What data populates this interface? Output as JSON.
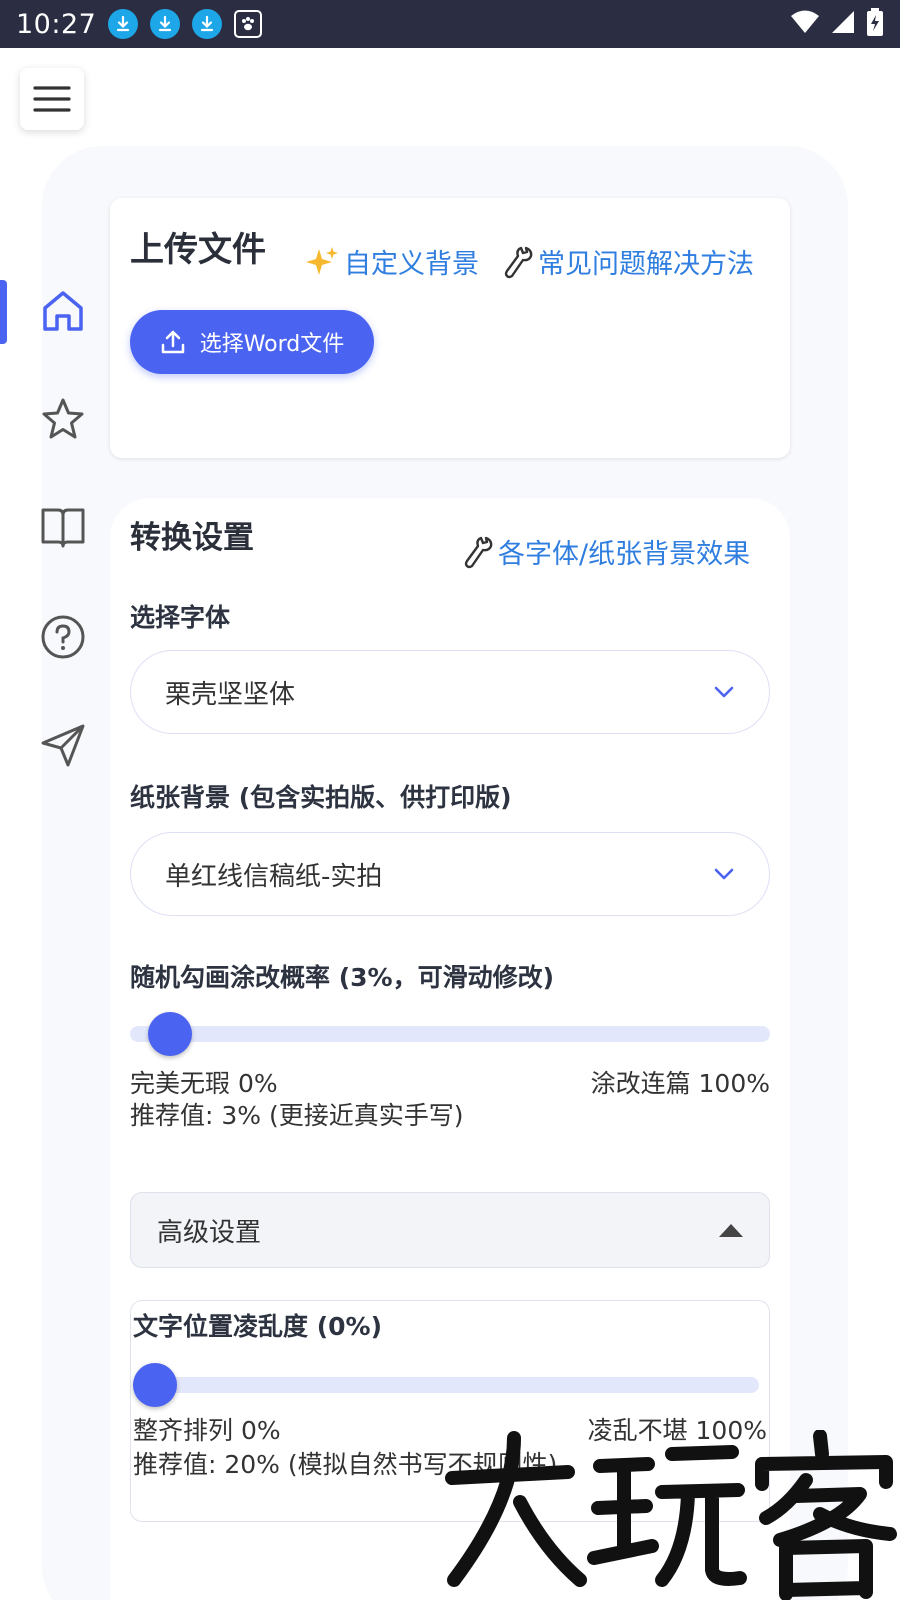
{
  "status_bar": {
    "time": "10:27"
  },
  "upload_card": {
    "title": "上传文件",
    "custom_bg_link": "自定义背景",
    "faq_link": "常见问题解决方法",
    "upload_button": "选择Word文件"
  },
  "settings_card": {
    "title": "转换设置",
    "effects_link": "各字体/纸张背景效果",
    "font_label": "选择字体",
    "font_value": "栗壳坚坚体",
    "paper_label": "纸张背景 (包含实拍版、供打印版)",
    "paper_value": "单红线信稿纸-实拍",
    "scribble_label": "随机勾画涂改概率 (3%，可滑动修改)",
    "scribble_value": 3,
    "scribble_min_label": "完美无瑕 0%",
    "scribble_max_label": "涂改连篇 100%",
    "scribble_recommend": "推荐值: 3% (更接近真实手写)",
    "advanced_label": "高级设置",
    "jitter_label": "文字位置凌乱度 (0%)",
    "jitter_value": 0,
    "jitter_min_label": "整齐排列 0%",
    "jitter_max_label": "凌乱不堪 100%",
    "jitter_recommend": "推荐值: 20% (模拟自然书写不规则性)"
  },
  "watermark": "大玩客",
  "colors": {
    "accent": "#4a63f0",
    "link": "#2f7ee0",
    "status_bar": "#2b2d42"
  }
}
